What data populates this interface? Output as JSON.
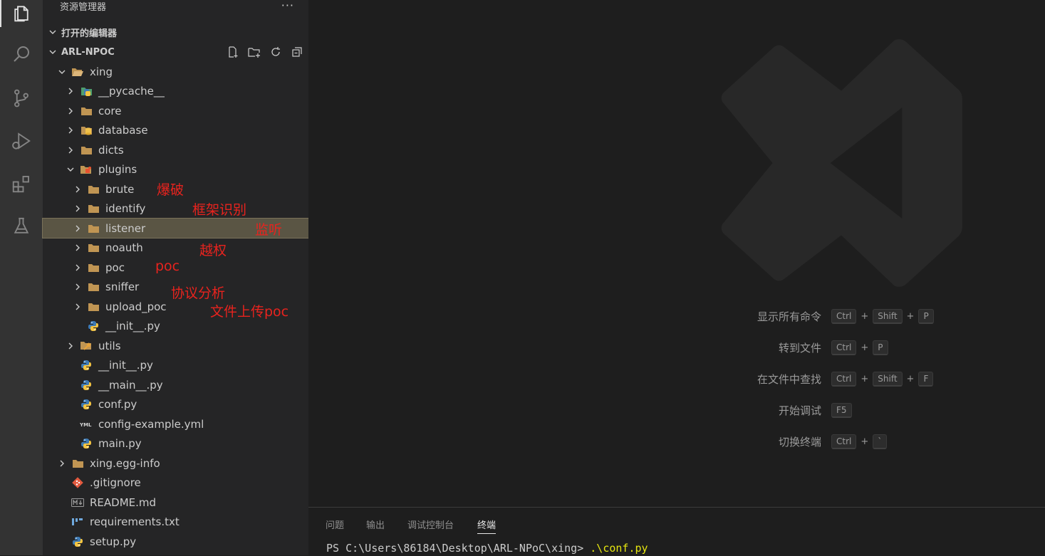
{
  "sidebar": {
    "title": "资源管理器",
    "more": "···",
    "open_editors": "打开的编辑器",
    "project": "ARL-NPOC"
  },
  "tree": [
    {
      "label": "xing",
      "depth": 0,
      "kind": "folder-open",
      "expanded": true
    },
    {
      "label": "__pycache__",
      "depth": 1,
      "kind": "pycache-folder",
      "expanded": false
    },
    {
      "label": "core",
      "depth": 1,
      "kind": "folder",
      "expanded": false
    },
    {
      "label": "database",
      "depth": 1,
      "kind": "db-folder",
      "expanded": false
    },
    {
      "label": "dicts",
      "depth": 1,
      "kind": "folder",
      "expanded": false
    },
    {
      "label": "plugins",
      "depth": 1,
      "kind": "plugin-folder",
      "expanded": true
    },
    {
      "label": "brute",
      "depth": 2,
      "kind": "folder",
      "expanded": false
    },
    {
      "label": "identify",
      "depth": 2,
      "kind": "folder",
      "expanded": false
    },
    {
      "label": "listener",
      "depth": 2,
      "kind": "folder",
      "expanded": false,
      "selected": true
    },
    {
      "label": "noauth",
      "depth": 2,
      "kind": "folder",
      "expanded": false
    },
    {
      "label": "poc",
      "depth": 2,
      "kind": "folder",
      "expanded": false
    },
    {
      "label": "sniffer",
      "depth": 2,
      "kind": "folder",
      "expanded": false
    },
    {
      "label": "upload_poc",
      "depth": 2,
      "kind": "folder",
      "expanded": false
    },
    {
      "label": "__init__.py",
      "depth": 2,
      "kind": "python-file"
    },
    {
      "label": "utils",
      "depth": 1,
      "kind": "utils-folder",
      "expanded": false
    },
    {
      "label": "__init__.py",
      "depth": 1,
      "kind": "python-file"
    },
    {
      "label": "__main__.py",
      "depth": 1,
      "kind": "python-file"
    },
    {
      "label": "conf.py",
      "depth": 1,
      "kind": "python-file"
    },
    {
      "label": "config-example.yml",
      "depth": 1,
      "kind": "yaml-file"
    },
    {
      "label": "main.py",
      "depth": 1,
      "kind": "python-file"
    },
    {
      "label": "xing.egg-info",
      "depth": 0,
      "kind": "folder",
      "expanded": false
    },
    {
      "label": ".gitignore",
      "depth": 0,
      "kind": "git-file"
    },
    {
      "label": "README.md",
      "depth": 0,
      "kind": "markdown-file"
    },
    {
      "label": "requirements.txt",
      "depth": 0,
      "kind": "requirements-file"
    },
    {
      "label": "setup.py",
      "depth": 0,
      "kind": "python-file"
    }
  ],
  "annotations": [
    {
      "text": "爆破"
    },
    {
      "text": "框架识别"
    },
    {
      "text": "监听"
    },
    {
      "text": "越权"
    },
    {
      "text": "poc"
    },
    {
      "text": "协议分析"
    },
    {
      "text": "文件上传poc"
    }
  ],
  "shortcuts": [
    {
      "label": "显示所有命令",
      "keys": [
        "Ctrl",
        "Shift",
        "P"
      ]
    },
    {
      "label": "转到文件",
      "keys": [
        "Ctrl",
        "P"
      ]
    },
    {
      "label": "在文件中查找",
      "keys": [
        "Ctrl",
        "Shift",
        "F"
      ]
    },
    {
      "label": "开始调试",
      "keys": [
        "F5"
      ]
    },
    {
      "label": "切换终端",
      "keys": [
        "Ctrl",
        "`"
      ]
    }
  ],
  "panel": {
    "tabs": [
      "问题",
      "输出",
      "调试控制台",
      "终端"
    ],
    "active_tab": "终端",
    "prompt": "PS C:\\Users\\86184\\Desktop\\ARL-NPoC\\xing> ",
    "command": ".\\conf.py"
  },
  "colors": {
    "annotation": "#e8231e",
    "folder": "#c09553",
    "selection": "#5a5544",
    "terminal_command": "#e5e510"
  }
}
